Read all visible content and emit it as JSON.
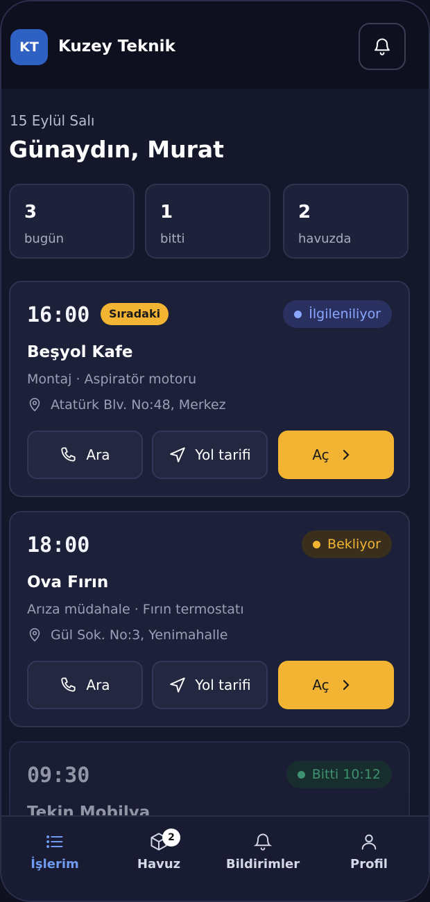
{
  "header": {
    "logo_text": "KT",
    "brand": "Kuzey Teknik",
    "bell_icon": "bell-icon"
  },
  "greeting": {
    "date": "15 Eylül Salı",
    "text": "Günaydın, Murat"
  },
  "stats": [
    {
      "value": "3",
      "label": "bugün"
    },
    {
      "value": "1",
      "label": "bitti"
    },
    {
      "value": "2",
      "label": "havuzda"
    }
  ],
  "jobs": [
    {
      "time": "16:00",
      "tag": "Sıradaki",
      "status": "İlgileniliyor",
      "status_color": "#8aa7ff",
      "status_bg": "#2a3160",
      "title": "Beşyol Kafe",
      "subtitle": "Montaj · Aspiratör motoru",
      "address": "Atatürk Blv. No:48, Merkez",
      "call": "Ara",
      "directions": "Yol tarifi",
      "open": "Aç"
    },
    {
      "time": "18:00",
      "tag": "",
      "status": "Bekliyor",
      "status_color": "#f2b432",
      "status_bg": "#3a2f1d",
      "title": "Ova Fırın",
      "subtitle": "Arıza müdahale · Fırın termostatı",
      "address": "Gül Sok. No:3, Yenimahalle",
      "call": "Ara",
      "directions": "Yol tarifi",
      "open": "Aç"
    },
    {
      "time": "09:30",
      "tag": "",
      "status": "Bitti 10:12",
      "status_color": "#4fc088",
      "status_bg": "#1a3630",
      "title": "Tekin Mobilya"
    }
  ],
  "nav": [
    {
      "label": "İşlerim",
      "icon": "list-icon",
      "active": true
    },
    {
      "label": "Havuz",
      "icon": "box-icon",
      "badge": "2"
    },
    {
      "label": "Bildirimler",
      "icon": "bell-icon"
    },
    {
      "label": "Profil",
      "icon": "user-icon"
    }
  ],
  "colors": {
    "accent": "#f2b432",
    "nav_active": "#6f9bf0",
    "background": "#15182b"
  }
}
